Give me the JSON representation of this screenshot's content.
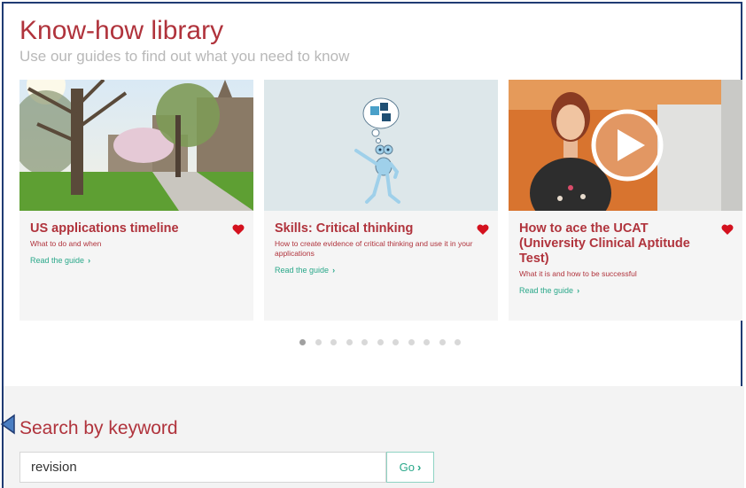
{
  "header": {
    "title": "Know-how library",
    "subtitle": "Use our guides to find out what you need to know"
  },
  "cards": [
    {
      "title": "US applications timeline",
      "description": "What to do and when",
      "link": "Read the guide",
      "image": "campus-photo"
    },
    {
      "title": "Skills: Critical thinking",
      "description": "How to create evidence of critical thinking and use it in your applications",
      "link": "Read the guide",
      "image": "frog-thinking-illustration"
    },
    {
      "title": "How to ace the UCAT (University Clinical Aptitude Test)",
      "description": "What it is and how to be successful",
      "link": "Read the guide",
      "image": "video-thumbnail"
    }
  ],
  "carousel": {
    "total_dots": 11,
    "active_index": 0
  },
  "search": {
    "title": "Search by keyword",
    "value": "revision",
    "button": "Go"
  },
  "colors": {
    "accent_red": "#b0333c",
    "link_green": "#2aa88a",
    "border_navy": "#1f3b73"
  }
}
